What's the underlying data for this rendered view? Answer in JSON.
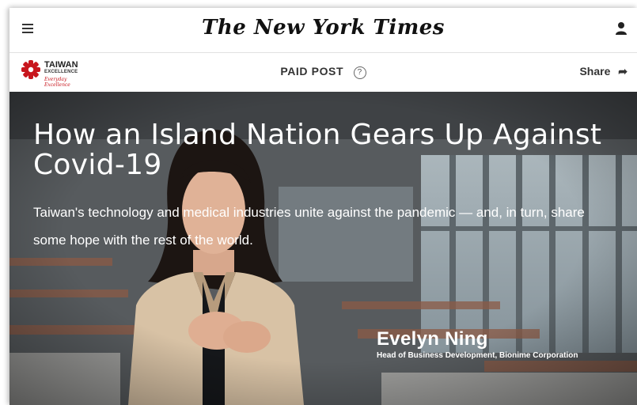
{
  "header": {
    "masthead": "The New York Times",
    "menu_icon": "hamburger-menu-icon",
    "account_icon": "user-icon"
  },
  "sponsor": {
    "brand_name": "TAIWAN",
    "brand_sub": "EXCELLENCE",
    "brand_tagline": "Everyday Excellence",
    "label": "PAID POST",
    "help_icon": "question-circle-icon",
    "help_glyph": "?",
    "share_label": "Share",
    "share_icon": "share-arrow-icon",
    "brand_color": "#c8161d"
  },
  "hero": {
    "headline": "How an Island Nation Gears Up Against Covid-19",
    "dek": "Taiwan's technology and medical industries unite against the pandemic — and, in turn, share some hope with the rest of the world.",
    "speaker_name": "Evelyn Ning",
    "speaker_title": "Head of Business Development, Bionime Corporation"
  }
}
